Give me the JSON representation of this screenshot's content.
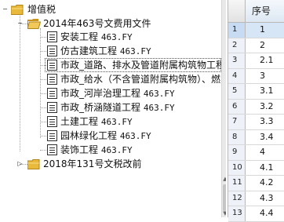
{
  "tree": {
    "root": {
      "label": "增值税",
      "expander": "−"
    },
    "groups": [
      {
        "label": "2014年463号文费用文件",
        "expander": "−",
        "items": [
          {
            "name": "安装工程",
            "code": "463.FY"
          },
          {
            "name": "仿古建筑工程",
            "code": "463.FY"
          },
          {
            "name": "市政_道路、排水及管道附属构筑物工程",
            "code": ""
          },
          {
            "name": "市政_给水（不含管道附属构筑物）、燃",
            "code": ""
          },
          {
            "name": "市政_河岸治理工程",
            "code": "463.FY"
          },
          {
            "name": "市政_桥涵隧道工程",
            "code": "463.FY"
          },
          {
            "name": "土建工程",
            "code": "463.FY"
          },
          {
            "name": "园林绿化工程",
            "code": "463.FY"
          },
          {
            "name": "装饰工程",
            "code": "463.FY"
          }
        ]
      },
      {
        "label": "2018年131号文税改前",
        "expander": "▷",
        "items": []
      }
    ],
    "scroll_arrows": {
      "up": "▲",
      "down": "▼"
    }
  },
  "grid": {
    "column_header": "序号",
    "rows": [
      {
        "num": "1",
        "value": "1",
        "active": true
      },
      {
        "num": "2",
        "value": "2"
      },
      {
        "num": "3",
        "value": "2.1"
      },
      {
        "num": "4",
        "value": "3"
      },
      {
        "num": "5",
        "value": "3.1"
      },
      {
        "num": "6",
        "value": "3.2"
      },
      {
        "num": "7",
        "value": "3.3"
      },
      {
        "num": "8",
        "value": "3.4"
      },
      {
        "num": "9",
        "value": "4"
      },
      {
        "num": "10",
        "value": "4.1"
      },
      {
        "num": "11",
        "value": "4.2"
      },
      {
        "num": "12",
        "value": "4.3"
      },
      {
        "num": "13",
        "value": "4.4"
      }
    ]
  },
  "colors": {
    "folder": "#e8b93a",
    "folder_dark": "#c9951f",
    "grid_active": "#d6e6f7",
    "header_bg": "#dde8f3"
  }
}
